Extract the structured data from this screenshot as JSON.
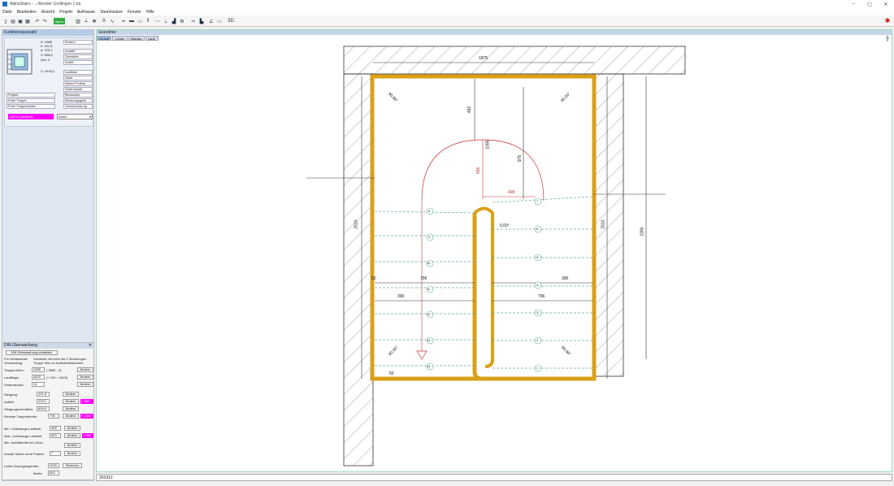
{
  "window": {
    "title": "AlphaStairs - ...\\Reeder Grellingen 1.trp",
    "controls": {
      "minimize": "–",
      "maximize": "▢",
      "close": "✕"
    }
  },
  "menu": [
    "Datei",
    "Bearbeiten",
    "Ansicht",
    "Projekt",
    "Aufmasse",
    "Stammsätze",
    "Fenster",
    "Hilfe"
  ],
  "toolbar": {
    "alpha_button": "alpha",
    "icons": [
      "new-icon",
      "open-icon",
      "save-icon",
      "print-icon",
      "undo-icon",
      "redo-icon",
      "grid-icon",
      "measure-icon",
      "move-icon",
      "text-icon",
      "curve-icon",
      "line-icon",
      "beam-icon",
      "rect-icon",
      "pause-icon",
      "dots-icon",
      "snap-icon",
      "car-icon",
      "gear-icon",
      "tools-icon",
      "stair-icon",
      "angle-icon",
      "ruler-icon",
      "view-3d-icon",
      "camera-icon"
    ],
    "btn_3d": "3D",
    "accent_red": "#dd0000"
  },
  "funktionsauswahl": {
    "title": "Funktionsauswahl",
    "values": [
      "H: 2685",
      "h: 191,8",
      "a: 225,1",
      "V: 608,6",
      "Anz: 0",
      "X: 2493,2"
    ],
    "buttons_right": [
      "Ändern",
      "Austritt",
      "Setzstufe",
      "Antritt",
      "Lauflinie",
      "Stufe",
      "Neues Podest",
      "Stufenkante",
      "Blockstufe",
      "Brüstungsgelä",
      "Verschraubung"
    ],
    "buttons_left": [
      "Projekt",
      "Freie Treppe",
      "Freie Treppenlinien"
    ],
    "norm_label": "DIN 5 (Lauflinie)",
    "wall_select": "Wand"
  },
  "din": {
    "title": "DIN Überwachung",
    "close": "✕",
    "settings_button": "DIN Überwachung einstellen",
    "gebaeudeart_label": "Für Gebäudeart:",
    "gebaeudeart_value": "Gebäude mit mehr als 2 Wohnungen",
    "verwendung_label": "Verwendung:",
    "verwendung_value": "Treppe führt zu Aufenthaltsräumen",
    "change": "Ändern",
    "rows": [
      {
        "label": "Treppenhöhe:",
        "value": "2685",
        "extra": "( 2685 - 0)"
      },
      {
        "label": "Lauflänge:",
        "value": "4523",
        "extra": "(+ 100 = 4623)"
      },
      {
        "label": "Stufenanzahl:",
        "value": "14",
        "extra": ""
      }
    ],
    "rows2": [
      {
        "label": "Steigung:",
        "value": "191,8",
        "warn": ""
      },
      {
        "label": "Auftritt:",
        "value": "225,1",
        "warn": "< 260"
      },
      {
        "label": "Steigungsverhältnis:",
        "value": "608,6",
        "warn": ""
      },
      {
        "label": "Kleinste Treppenbreite:",
        "value": "796",
        "warn": "< 1000"
      }
    ],
    "rows3": [
      {
        "label": "Min. Lichtwange-Lauflinie:",
        "value": "405",
        "warn": ""
      },
      {
        "label": "Max. Lichtwange-Lauflinie:",
        "value": "603",
        "warn": "> 550"
      },
      {
        "label": "Min. Auftrittbreite bei 15cm:",
        "value": "",
        "warn": ""
      },
      {
        "label": "Anzahl Stufen ohne Podest:",
        "value": "7",
        "warn": ""
      }
    ],
    "durchgang_label": "Lichte Durchgangshöhe:",
    "durchgang_value": "2000",
    "rechnen": "Rechnen",
    "breite_label": "Breite:",
    "breite_value": "600"
  },
  "canvas": {
    "title": "Grundriss",
    "tabs": [
      "Grundr",
      "Lichtw.",
      "Wandw.",
      "Laufl."
    ]
  },
  "drawing": {
    "dims": [
      "1875",
      "492",
      "1095",
      "975",
      "498",
      "498",
      "2510",
      "2510",
      "2390",
      "796",
      "796",
      "390",
      "390",
      "50",
      "50"
    ],
    "angles": [
      "90,00°",
      "90,00°",
      "90,00°",
      "90,00°",
      "0,00°"
    ],
    "step_numbers_left": [
      "8",
      "9",
      "10",
      "11",
      "12",
      "13",
      "14"
    ],
    "step_numbers_right": [
      "7",
      "6",
      "5",
      "4",
      "3",
      "2",
      "1"
    ],
    "stringer_color": "#d9a019"
  },
  "status": {
    "text": "201912"
  }
}
